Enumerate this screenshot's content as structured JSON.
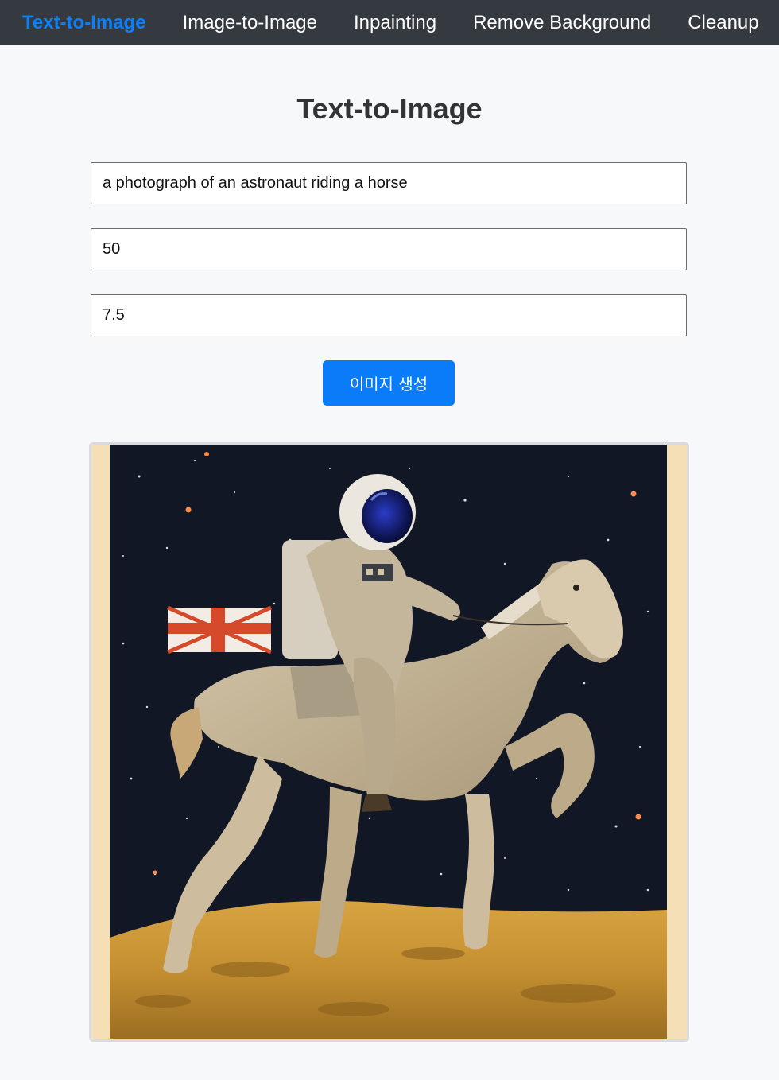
{
  "nav": {
    "items": [
      {
        "label": "Text-to-Image",
        "active": true
      },
      {
        "label": "Image-to-Image",
        "active": false
      },
      {
        "label": "Inpainting",
        "active": false
      },
      {
        "label": "Remove Background",
        "active": false
      },
      {
        "label": "Cleanup",
        "active": false
      }
    ]
  },
  "main": {
    "title": "Text-to-Image",
    "prompt_value": "a photograph of an astronaut riding a horse",
    "steps_value": "50",
    "guidance_value": "7.5",
    "generate_label": "이미지 생성"
  },
  "result": {
    "image_subject": "astronaut-riding-horse-on-moon"
  },
  "colors": {
    "navbar_bg": "#343a40",
    "nav_active": "#0d7ff8",
    "button_bg": "#0a7cfa",
    "page_bg": "#f7f8fa"
  }
}
